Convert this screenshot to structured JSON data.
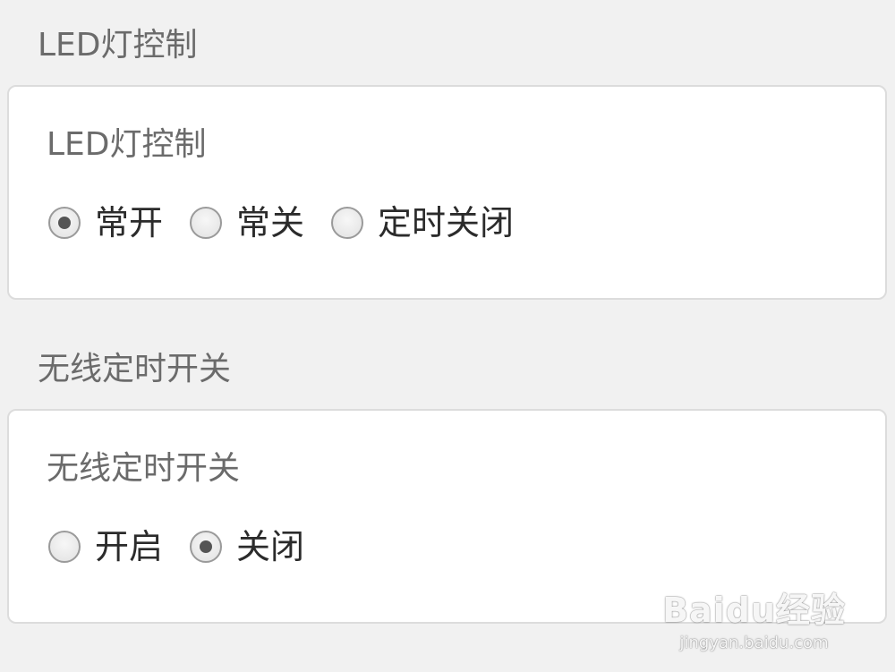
{
  "sections": [
    {
      "header": "LED灯控制",
      "card_title": "LED灯控制",
      "options": [
        {
          "label": "常开",
          "checked": true
        },
        {
          "label": "常关",
          "checked": false
        },
        {
          "label": "定时关闭",
          "checked": false
        }
      ]
    },
    {
      "header": "无线定时开关",
      "card_title": "无线定时开关",
      "options": [
        {
          "label": "开启",
          "checked": false
        },
        {
          "label": "关闭",
          "checked": true
        }
      ]
    }
  ],
  "watermark": {
    "logo": "Baidu经验",
    "url": "jingyan.baidu.com"
  },
  "colors": {
    "background": "#f1f1f1",
    "card": "#ffffff",
    "header_text": "#6b6b6b",
    "option_text": "#2b2b2b",
    "radio_dot": "#555555"
  }
}
